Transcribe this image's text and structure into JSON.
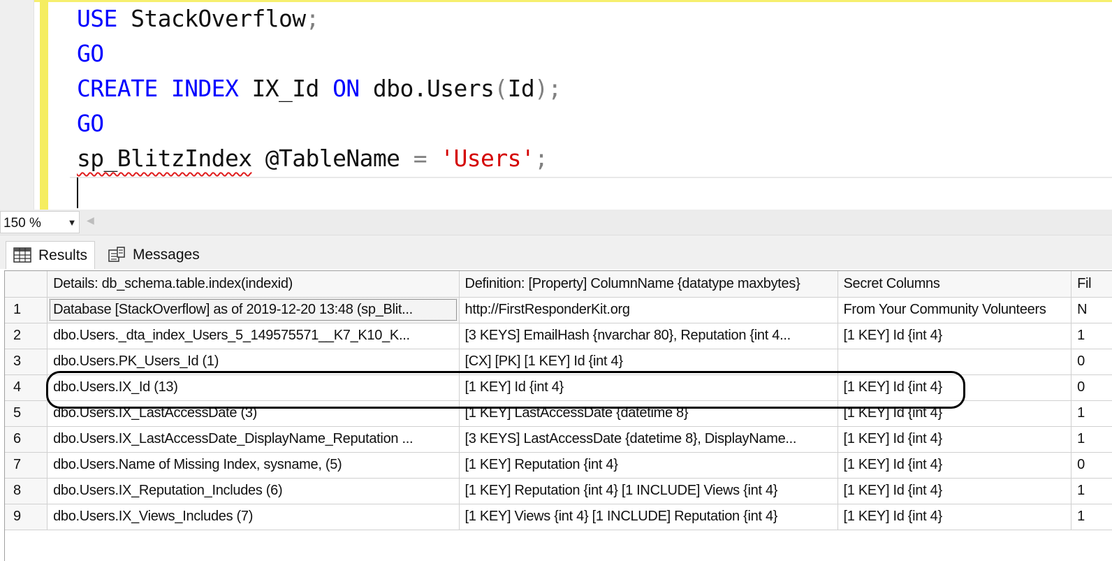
{
  "editor": {
    "lines": [
      {
        "t1": "USE",
        "t2": " StackOverflow",
        "t3": ";"
      },
      {
        "t1": "GO"
      },
      {
        "k1": "CREATE",
        "k2": " INDEX",
        "id": " IX_Id",
        "k3": " ON",
        "obj": " dbo.Users",
        "p1": "(",
        "col": "Id",
        "p2": ");"
      },
      {
        "t1": "GO"
      },
      {
        "proc": "sp_BlitzIndex",
        "param": " @TableName",
        "eq": " =",
        "str": " 'Users'",
        "semi": ";"
      }
    ]
  },
  "zoom": {
    "value": "150 %"
  },
  "tabs": [
    {
      "label": "Results",
      "icon": "grid-icon"
    },
    {
      "label": "Messages",
      "icon": "messages-icon"
    }
  ],
  "grid": {
    "columns": [
      "",
      "Details: db_schema.table.index(indexid)",
      "Definition: [Property] ColumnName {datatype maxbytes}",
      "Secret Columns",
      "Fil"
    ],
    "rows": [
      [
        "1",
        "Database [StackOverflow] as of 2019-12-20 13:48 (sp_Blit...",
        "http://FirstResponderKit.org",
        "From Your Community Volunteers",
        "N"
      ],
      [
        "2",
        "dbo.Users._dta_index_Users_5_149575571__K7_K10_K...",
        "[3 KEYS] EmailHash {nvarchar 80}, Reputation {int 4...",
        "[1 KEY] Id {int 4}",
        "1"
      ],
      [
        "3",
        "dbo.Users.PK_Users_Id (1)",
        "[CX] [PK] [1 KEY] Id {int 4}",
        "",
        "0"
      ],
      [
        "4",
        "dbo.Users.IX_Id (13)",
        "[1 KEY] Id {int 4}",
        "[1 KEY] Id {int 4}",
        "0"
      ],
      [
        "5",
        "dbo.Users.IX_LastAccessDate (3)",
        "[1 KEY] LastAccessDate {datetime 8}",
        "[1 KEY] Id {int 4}",
        "1"
      ],
      [
        "6",
        "dbo.Users.IX_LastAccessDate_DisplayName_Reputation ...",
        "[3 KEYS] LastAccessDate {datetime 8}, DisplayName...",
        "[1 KEY] Id {int 4}",
        "1"
      ],
      [
        "7",
        "dbo.Users.Name of Missing Index, sysname, (5)",
        "[1 KEY] Reputation {int 4}",
        "[1 KEY] Id {int 4}",
        "0"
      ],
      [
        "8",
        "dbo.Users.IX_Reputation_Includes (6)",
        "[1 KEY] Reputation {int 4} [1 INCLUDE]  Views {int 4}",
        "[1 KEY] Id {int 4}",
        "1"
      ],
      [
        "9",
        "dbo.Users.IX_Views_Includes (7)",
        "[1 KEY] Views {int 4} [1 INCLUDE]  Reputation {int 4}",
        "[1 KEY] Id {int 4}",
        "1"
      ]
    ]
  }
}
